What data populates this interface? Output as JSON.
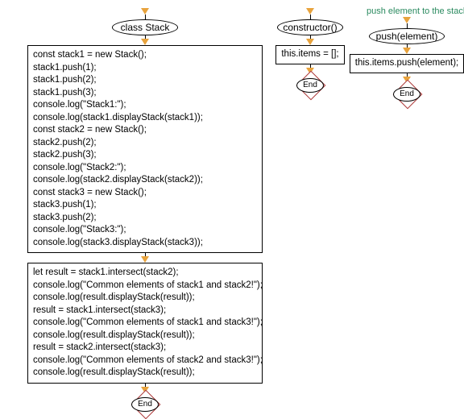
{
  "main": {
    "header": "class Stack",
    "box1_lines": [
      "const stack1 = new Stack();",
      "stack1.push(1);",
      "stack1.push(2);",
      "stack1.push(3);",
      "console.log(\"Stack1:\");",
      "console.log(stack1.displayStack(stack1));",
      "const stack2 = new Stack();",
      "stack2.push(2);",
      "stack2.push(3);",
      "console.log(\"Stack2:\");",
      "console.log(stack2.displayStack(stack2));",
      "const stack3 = new Stack();",
      "stack3.push(1);",
      "stack3.push(2);",
      "console.log(\"Stack3:\");",
      "console.log(stack3.displayStack(stack3));"
    ],
    "box2_lines": [
      "let result = stack1.intersect(stack2);",
      "console.log(\"Common elements of stack1 and stack2!\");",
      "console.log(result.displayStack(result));",
      "result = stack1.intersect(stack3);",
      "console.log(\"Common elements of stack1 and stack3!\");",
      "console.log(result.displayStack(result));",
      "result = stack2.intersect(stack3);",
      "console.log(\"Common elements of stack2 and stack3!\");",
      "console.log(result.displayStack(result));"
    ],
    "end": "End"
  },
  "constructor": {
    "header": "constructor()",
    "body": "this.items = [];",
    "end": "End"
  },
  "push": {
    "annotation": "push element to the stack",
    "header": "push(element)",
    "body": "this.items.push(element);",
    "end": "End"
  }
}
